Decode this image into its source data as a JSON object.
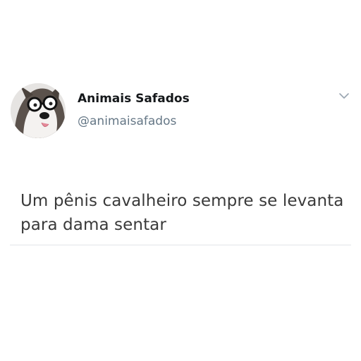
{
  "tweet": {
    "author": {
      "display_name": "Animais Safados",
      "handle": "@animaisafados",
      "avatar_icon": "husky-dog-with-glasses-avatar"
    },
    "menu_icon": "chevron-down-icon",
    "text": "Um pênis cavalheiro sempre se levanta para dama sentar"
  },
  "colors": {
    "background": "#ffffff",
    "name": "#14171a",
    "handle": "#657786",
    "body_text": "#3a3a3a",
    "divider": "#e1e5e8",
    "caret": "#9aa5b1"
  }
}
